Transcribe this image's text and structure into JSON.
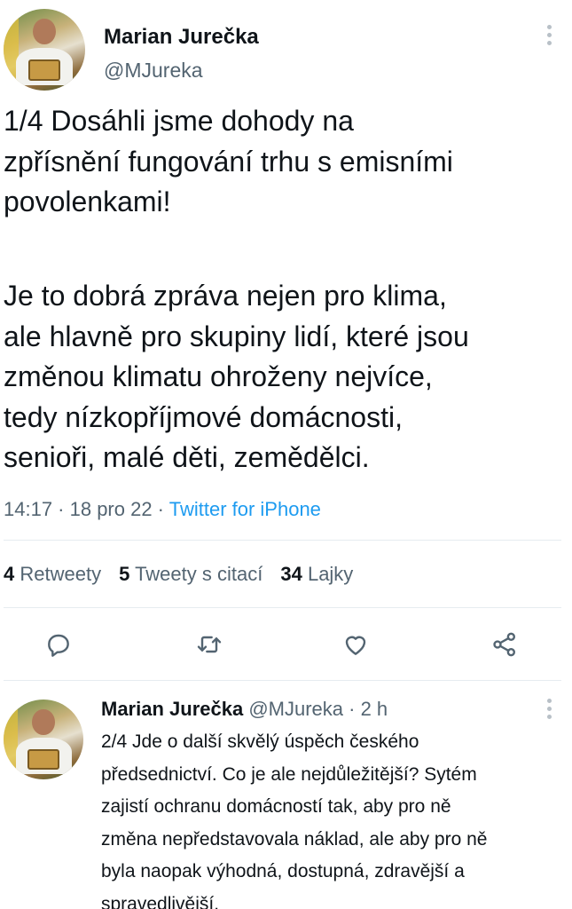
{
  "tweet": {
    "author_name": "Marian Jurečka",
    "author_handle": "@MJureka",
    "paragraph1": "1/4 Dosáhli jsme dohody na\nzpřísnění fungování trhu s emisními\npovolenkami!",
    "paragraph2": "Je to dobrá zpráva nejen pro klima,\nale hlavně pro skupiny lidí, které jsou\nzměnou klimatu ohroženy nejvíce,\ntedy nízkopříjmové domácnosti,\nsenioři, malé děti, zemědělci.",
    "time": "14:17 · 18 pro 22 · ",
    "source": "Twitter for iPhone",
    "stats": {
      "retweets_count": "4",
      "retweets_label": "Retweety",
      "quotes_count": "5",
      "quotes_label": "Tweety s citací",
      "likes_count": "34",
      "likes_label": "Lajky"
    }
  },
  "reply": {
    "author_name": "Marian Jurečka",
    "author_handle_time": "@MJureka · 2 h",
    "text": "2/4 Jde o další skvělý úspěch českého\npředsednictví. Co je ale nejdůležitější? Sytém\nzajistí ochranu domácností tak, aby pro ně\nzměna nepředstavovala náklad, ale aby pro ně\nbyla naopak výhodná, dostupná, zdravější a\nspravedlivější."
  },
  "icons": {
    "reply": "speech-bubble-icon",
    "retweet": "retweet-arrows-icon",
    "like": "heart-icon",
    "share": "share-nodes-icon",
    "more": "vertical-dots-icon"
  },
  "colors": {
    "accent": "#1d9bf0",
    "muted": "#536471",
    "text": "#0f1419",
    "divider": "#e6ecf0"
  }
}
